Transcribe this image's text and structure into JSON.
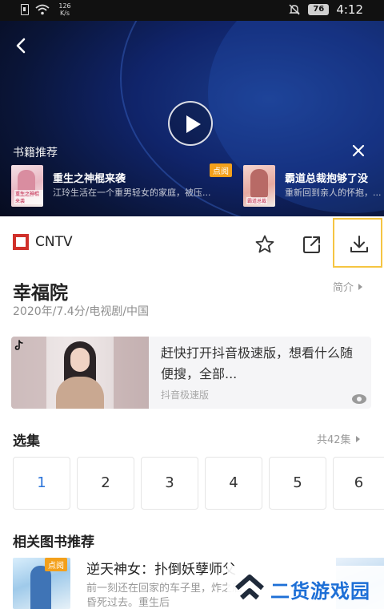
{
  "status_bar": {
    "net_speed_value": "126",
    "net_speed_unit": "K/s",
    "battery": "76",
    "time": "4:12"
  },
  "player": {
    "book_rec_title": "书籍推荐",
    "books": [
      {
        "name": "重生之神棍来袭",
        "desc": "江玲生活在一个重男轻女的家庭，被压...",
        "badge": "点阅",
        "cover_text": "重生之神棍来袭"
      },
      {
        "name": "霸道总裁抱够了没",
        "desc": "重新回到亲人的怀抱，...",
        "cover_text": "霸道总裁"
      }
    ]
  },
  "source": {
    "label": "CNTV"
  },
  "show": {
    "title": "幸福院",
    "intro_link": "简介",
    "meta": "2020年/7.4分/电视剧/中国"
  },
  "ad": {
    "text": "赶快打开抖音极速版，想看什么随便搜，全部...",
    "source": "抖音极速版"
  },
  "episodes": {
    "title": "选集",
    "count": "共42集",
    "items": [
      "1",
      "2",
      "3",
      "4",
      "5",
      "6"
    ]
  },
  "related": {
    "title": "相关图书推荐",
    "badge": "点阅",
    "name": "逆天神女：扑倒妖孽师父",
    "desc": "前一刻还在回家的车子里，炸之后昏死过去。重生后"
  },
  "watermark": {
    "text": "二货游戏园"
  },
  "colors": {
    "accent_blue": "#2a73d9",
    "highlight_border": "#f5c542",
    "badge_orange": "#f3a01b",
    "cntv_red": "#d0302a"
  }
}
